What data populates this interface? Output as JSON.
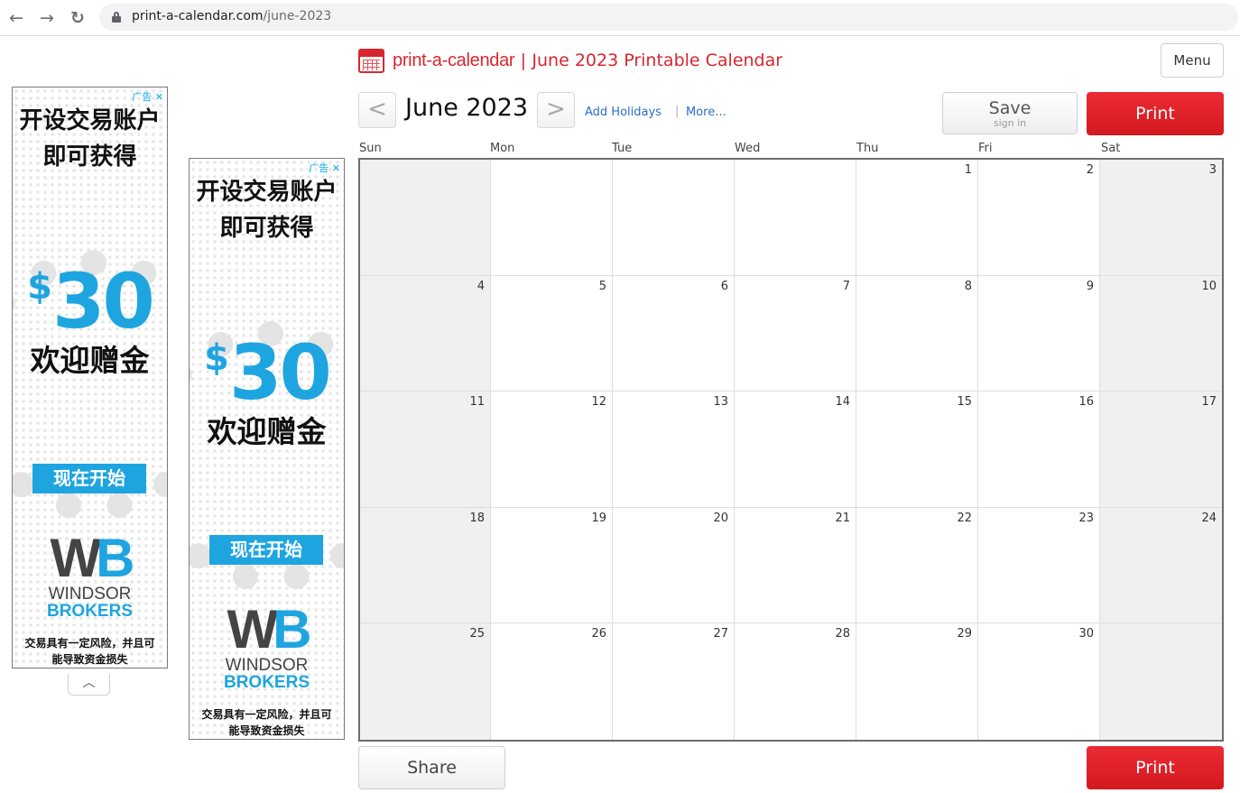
{
  "browser": {
    "back": "←",
    "forward": "→",
    "reload": "↻",
    "url_domain": "print-a-calendar.com",
    "url_path": "/june-2023"
  },
  "ads": {
    "close_label": "广告 ✕",
    "title_line1": "开设交易账户",
    "title_line2": "即可获得",
    "currency": "$",
    "amount": "30",
    "welcome": "欢迎赠金",
    "cta": "现在开始",
    "logo_w": "W",
    "logo_b": "B",
    "brand_line1": "WINDSOR",
    "brand_line2": "BROKERS",
    "risk_line1": "交易具有一定风险，并且可",
    "risk_line2": "能导致资金损失",
    "collapse": "︿"
  },
  "header": {
    "site_name": "print-a-calendar",
    "separator": "|",
    "page_title": "June 2023 Printable Calendar",
    "menu": "Menu"
  },
  "toolbar": {
    "prev": "<",
    "next": ">",
    "month_title": "June 2023",
    "add_holidays": "Add Holidays",
    "link_sep": "|",
    "more": "More...",
    "save": "Save",
    "save_sub": "sign in",
    "print": "Print"
  },
  "calendar": {
    "weekdays": [
      "Sun",
      "Mon",
      "Tue",
      "Wed",
      "Thu",
      "Fri",
      "Sat"
    ],
    "weeks": [
      [
        "",
        "",
        "",
        "",
        "1",
        "2",
        "3"
      ],
      [
        "4",
        "5",
        "6",
        "7",
        "8",
        "9",
        "10"
      ],
      [
        "11",
        "12",
        "13",
        "14",
        "15",
        "16",
        "17"
      ],
      [
        "18",
        "19",
        "20",
        "21",
        "22",
        "23",
        "24"
      ],
      [
        "25",
        "26",
        "27",
        "28",
        "29",
        "30",
        ""
      ]
    ]
  },
  "footer": {
    "share": "Share",
    "print": "Print"
  },
  "colors": {
    "brand_red": "#d8262f",
    "link_blue": "#2a6fc9",
    "ad_blue": "#1ea5e0"
  }
}
